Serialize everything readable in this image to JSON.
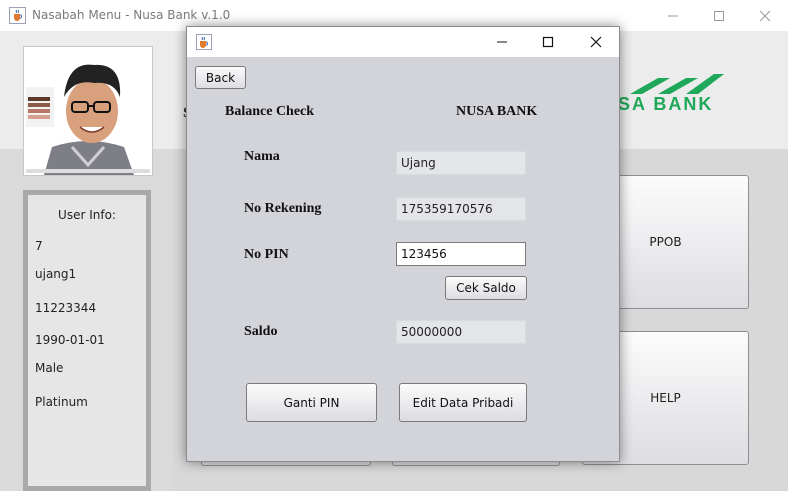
{
  "main_window": {
    "title": "Nasabah Menu - Nusa Bank v.1.0",
    "header_partial_letter": "S",
    "logo_text": "SA BANK",
    "user_info": {
      "title": "User Info:",
      "fields": [
        "7",
        "ujang1",
        "11223344",
        "1990-01-01",
        "Male",
        "Platinum"
      ]
    },
    "menu_buttons": {
      "ppob": "PPOB",
      "help": "HELP"
    }
  },
  "dialog": {
    "back_label": "Back",
    "heading": "Balance Check",
    "bank_name": "NUSA BANK",
    "nama_label": "Nama",
    "nama_value": "Ujang",
    "rekening_label": "No Rekening",
    "rekening_value": "175359170576",
    "pin_label": "No PIN",
    "pin_value": "123456",
    "cek_saldo_label": "Cek Saldo",
    "saldo_label": "Saldo",
    "saldo_value": "50000000",
    "ganti_pin_label": "Ganti PIN",
    "edit_data_label": "Edit Data Pribadi"
  },
  "colors": {
    "logo_green": "#1fa85a",
    "dialog_bg": "#d3d4d9"
  },
  "icons": [
    "java-cup-icon",
    "minimize-icon",
    "maximize-icon",
    "close-icon"
  ]
}
